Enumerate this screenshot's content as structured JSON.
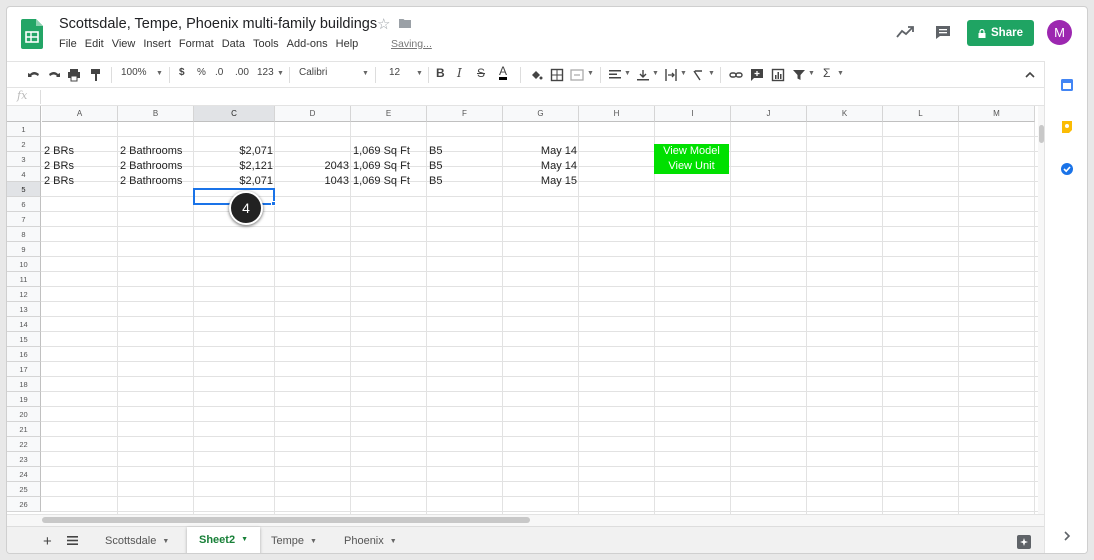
{
  "header": {
    "title": "Scottsdale, Tempe, Phoenix multi-family buildings",
    "saving": "Saving...",
    "share_label": "Share",
    "avatar_letter": "M"
  },
  "menu": [
    "File",
    "Edit",
    "View",
    "Insert",
    "Format",
    "Data",
    "Tools",
    "Add-ons",
    "Help"
  ],
  "toolbar": {
    "zoom": "100%",
    "currency": "$",
    "percent": "%",
    "dec_decrease": ".0",
    "dec_increase": ".00",
    "format_more": "123",
    "font": "Calibri",
    "font_size": "12",
    "bold": "B",
    "italic": "I",
    "strike": "S",
    "text_color": "A",
    "sum": "Σ"
  },
  "formula_bar": {
    "fx": "fx"
  },
  "columns": [
    "A",
    "B",
    "C",
    "D",
    "E",
    "F",
    "G",
    "H",
    "I",
    "J",
    "K",
    "L",
    "M"
  ],
  "rows": [
    "1",
    "2",
    "3",
    "4",
    "5",
    "6",
    "7",
    "8",
    "9",
    "10",
    "11",
    "12",
    "13",
    "14",
    "15",
    "16",
    "17",
    "18",
    "19",
    "20",
    "21",
    "22",
    "23",
    "24",
    "25",
    "26"
  ],
  "cells": {
    "r2": {
      "a": "2 BRs",
      "b": "2 Bathrooms",
      "c": "$2,071",
      "d": "",
      "e": "1,069 Sq Ft",
      "f": "B5",
      "g": "May 14",
      "i": "View Model"
    },
    "r3": {
      "a": "2 BRs",
      "b": "2 Bathrooms",
      "c": "$2,121",
      "d": "2043",
      "e": "1,069 Sq Ft",
      "f": "B5",
      "g": "May 14",
      "i": "View Unit"
    },
    "r4": {
      "a": "2 BRs",
      "b": "2 Bathrooms",
      "c": "$2,071",
      "d": "1043",
      "e": "1,069 Sq Ft",
      "f": "B5",
      "g": "May 15"
    }
  },
  "step_badge": "4",
  "sheet_tabs": [
    {
      "label": "Scottsdale",
      "active": false
    },
    {
      "label": "Sheet2",
      "active": true
    },
    {
      "label": "Tempe",
      "active": false
    },
    {
      "label": "Phoenix",
      "active": false
    }
  ],
  "colors": {
    "share_green": "#1fa463",
    "cell_green": "#00e000",
    "select_blue": "#1a73e8",
    "active_tab_green": "#188038"
  }
}
